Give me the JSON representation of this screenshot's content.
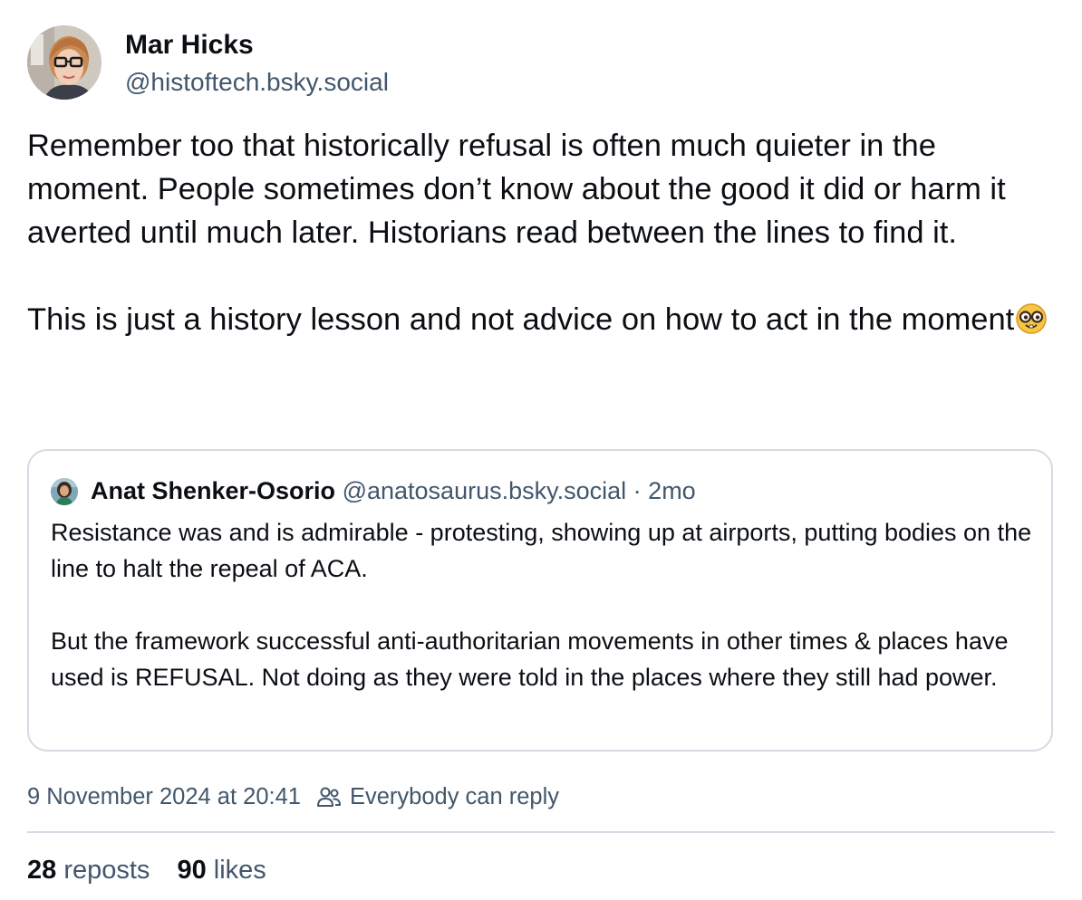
{
  "author": {
    "display_name": "Mar Hicks",
    "handle": "@histoftech.bsky.social"
  },
  "post": {
    "paragraphs": [
      "Remember too that historically refusal is often much quieter in the moment. People sometimes don’t know about the good it did or harm it averted until much later. Historians read between the lines to find it.",
      "This is just a history lesson and not advice on how to act in the moment"
    ],
    "emoji": "nerd-face"
  },
  "quoted_post": {
    "display_name": "Anat Shenker-Osorio",
    "handle": "@anatosaurus.bsky.social",
    "separator": "·",
    "age": "2mo",
    "paragraphs": [
      "Resistance was and is admirable - protesting, showing up at airports, putting bodies on the line to halt the repeal of ACA.",
      "But the framework successful anti-authoritarian movements in other times & places have used is REFUSAL. Not doing as they were told in the places where they still had power."
    ]
  },
  "meta": {
    "timestamp": "9 November 2024 at 20:41",
    "reply_setting": "Everybody can reply",
    "reply_icon": "people-icon"
  },
  "stats": {
    "reposts_count": "28",
    "reposts_label": "reposts",
    "likes_count": "90",
    "likes_label": "likes"
  },
  "colors": {
    "text": "#0b0f14",
    "muted": "#42576c",
    "border": "#d4dbe2"
  }
}
